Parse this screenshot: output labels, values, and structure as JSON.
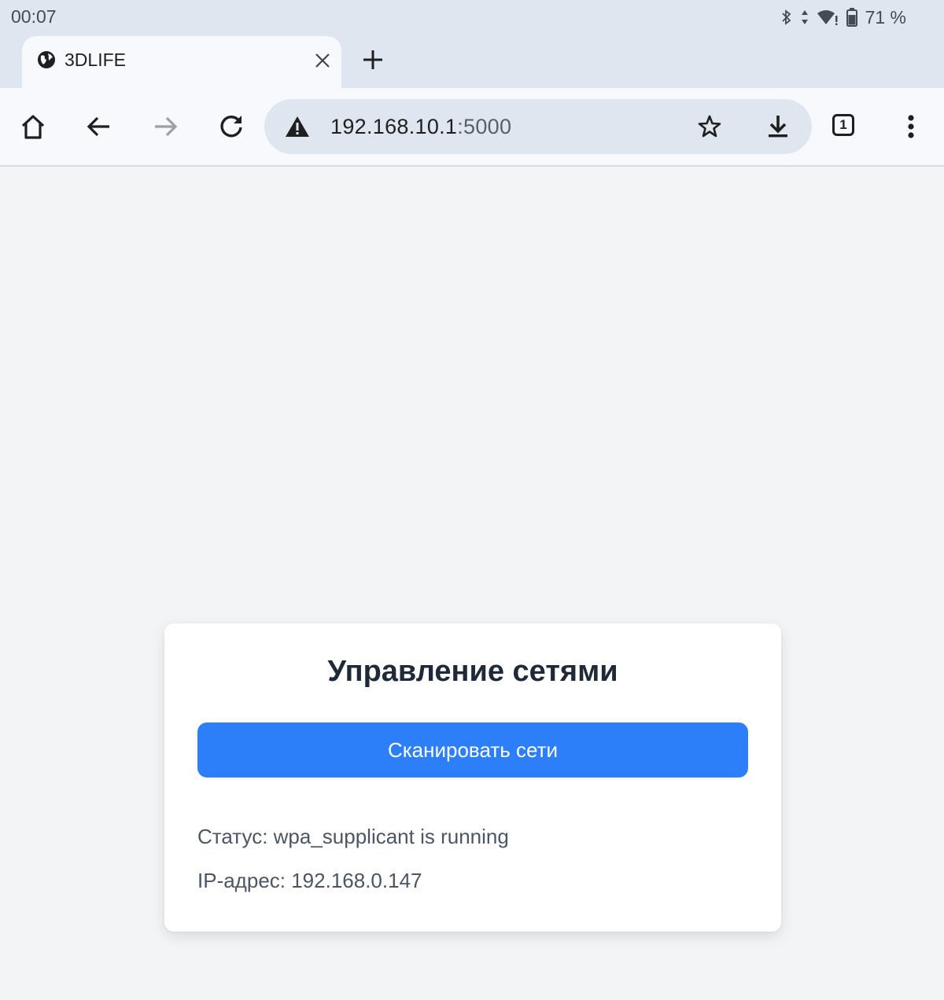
{
  "status_bar": {
    "time": "00:07",
    "battery": "71 %",
    "icons": [
      "bluetooth-icon",
      "data-arrows-icon",
      "wifi-icon",
      "battery-icon"
    ]
  },
  "tab": {
    "title": "3DLIFE",
    "icon": "globe-icon"
  },
  "toolbar": {
    "url_host": "192.168.10.1",
    "url_port": ":5000",
    "tab_count": "1",
    "icons": [
      "home-icon",
      "back-arrow-icon",
      "forward-arrow-icon",
      "reload-icon",
      "warning-icon",
      "star-icon",
      "download-icon",
      "more-vert-icon"
    ]
  },
  "card": {
    "title": "Управление сетями",
    "scan_button": "Сканировать сети",
    "status_line": "Статус: wpa_supplicant is running",
    "ip_line": "IP-адрес: 192.168.0.147"
  },
  "colors": {
    "accent": "#2d7ff9",
    "page_bg": "#f3f4f6",
    "chrome_bg": "#dfe6f0",
    "title_text": "#1f2937",
    "body_text": "#4b5563"
  }
}
